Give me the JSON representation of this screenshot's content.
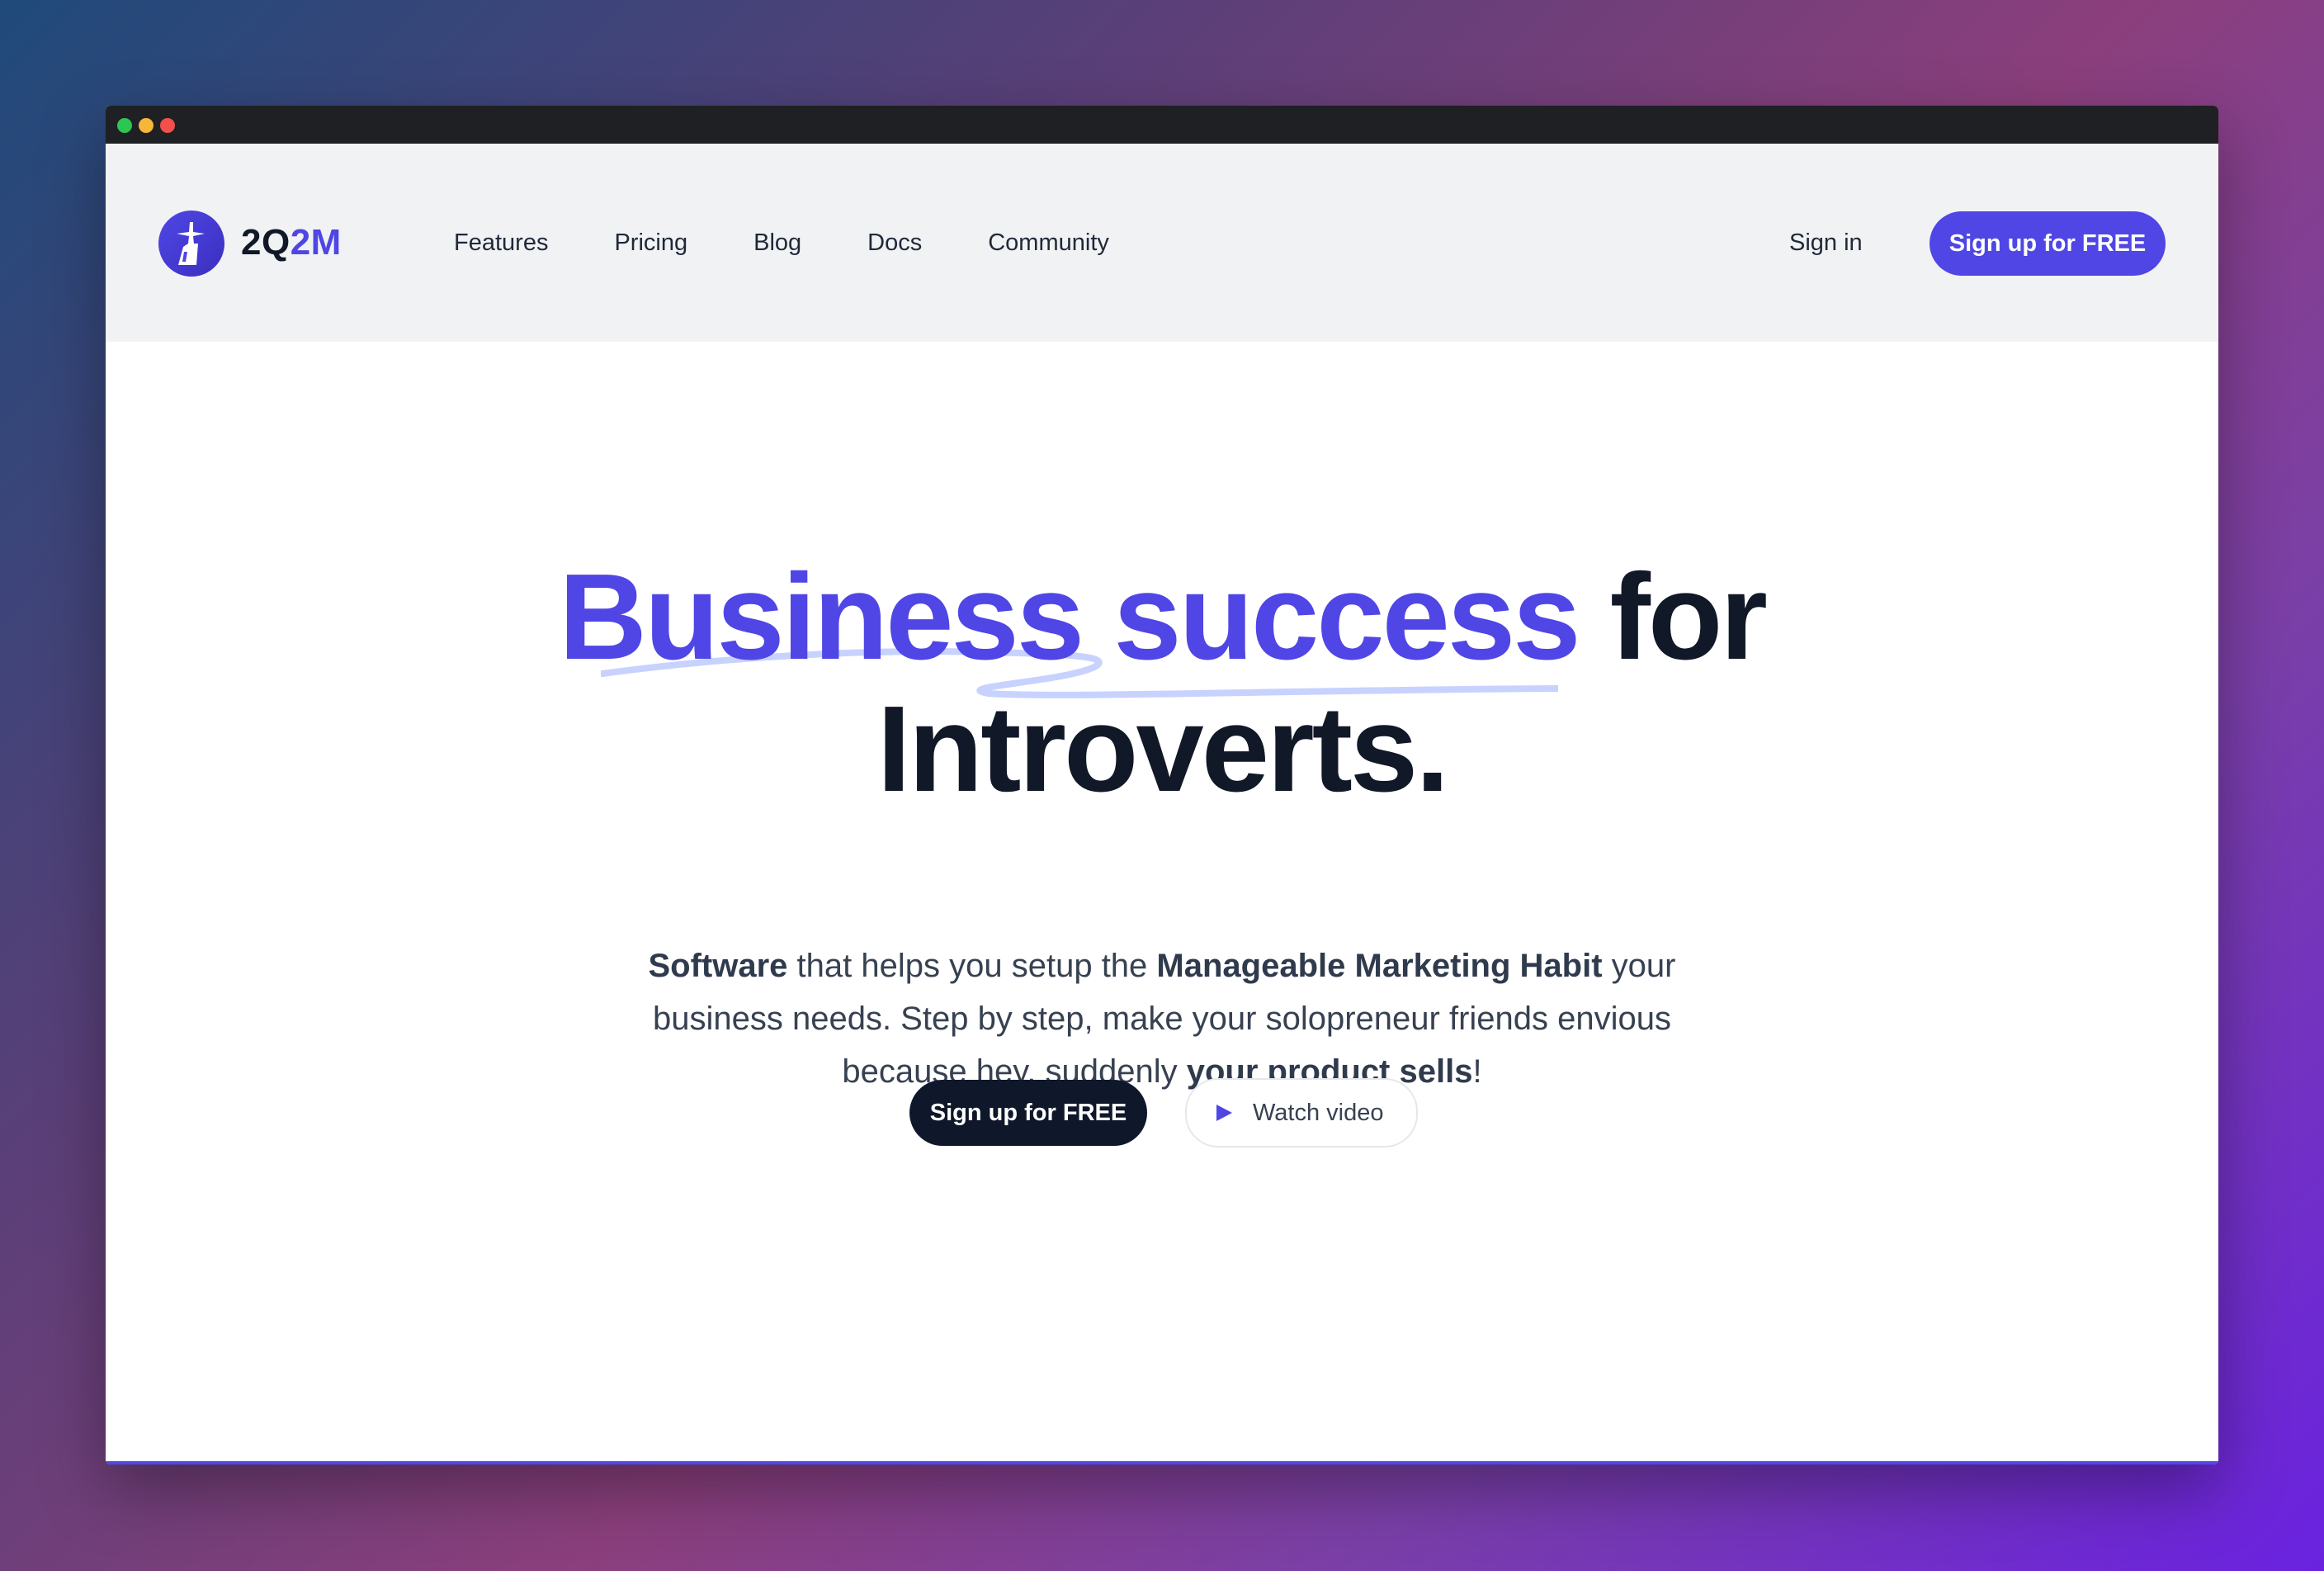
{
  "window": {
    "controls": [
      "green",
      "yellow",
      "red"
    ]
  },
  "nav": {
    "logo_icon": "statue-logo-icon",
    "brand_part1": "2Q",
    "brand_part2": "2M",
    "links": [
      "Features",
      "Pricing",
      "Blog",
      "Docs",
      "Community"
    ],
    "signin_label": "Sign in",
    "signup_label": "Sign up for FREE"
  },
  "hero": {
    "title_accent": "Business success",
    "title_rest_line1": " for",
    "title_line2": "Introverts.",
    "subtitle": {
      "b1": "Software",
      "t1": " that helps you setup the ",
      "b2": "Manageable Marketing Habit",
      "t2": " your business needs. Step by step, make your solopreneur friends envious because hey, suddenly ",
      "b3": "your product sells",
      "t3": "!"
    },
    "cta_primary": "Sign up for FREE",
    "cta_video": "Watch video"
  },
  "colors": {
    "accent": "#4f46e5",
    "dark": "#0f172a",
    "nav_bg": "#f1f2f4",
    "squiggle": "#c7d2fe"
  }
}
